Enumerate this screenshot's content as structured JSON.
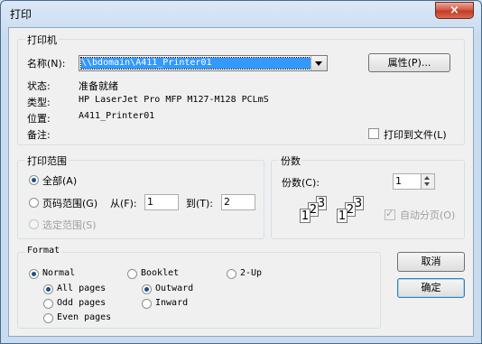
{
  "window": {
    "title": "打印",
    "close_icon": "×"
  },
  "printer": {
    "group_label": "打印机",
    "name_label": "名称(N):",
    "name_value": "\\\\bdomain\\A411_Printer01",
    "properties_button": "属性(P)...",
    "status_label": "状态:",
    "status_value": "准备就绪",
    "type_label": "类型:",
    "type_value": "HP LaserJet Pro MFP M127-M128 PCLmS",
    "location_label": "位置:",
    "location_value": "A411_Printer01",
    "comment_label": "备注:",
    "print_to_file": "打印到文件(L)"
  },
  "range": {
    "group_label": "打印范围",
    "all": "全部(A)",
    "pages": "页码范围(G)",
    "from_label": "从(F):",
    "from_value": "1",
    "to_label": "到(T):",
    "to_value": "2",
    "selection": "选定范围(S)"
  },
  "copies": {
    "group_label": "份数",
    "count_label": "份数(C):",
    "count_value": "1",
    "collate": "自动分页(O)",
    "collate_icons": [
      "1",
      "2",
      "3",
      "1",
      "2",
      "3"
    ]
  },
  "format": {
    "group_label": "Format",
    "normal": "Normal",
    "booklet": "Booklet",
    "two_up": "2-Up",
    "all_pages": "All pages",
    "odd_pages": "Odd pages",
    "even_pages": "Even pages",
    "outward": "Outward",
    "inward": "Inward"
  },
  "actions": {
    "cancel": "取消",
    "ok": "确定"
  }
}
